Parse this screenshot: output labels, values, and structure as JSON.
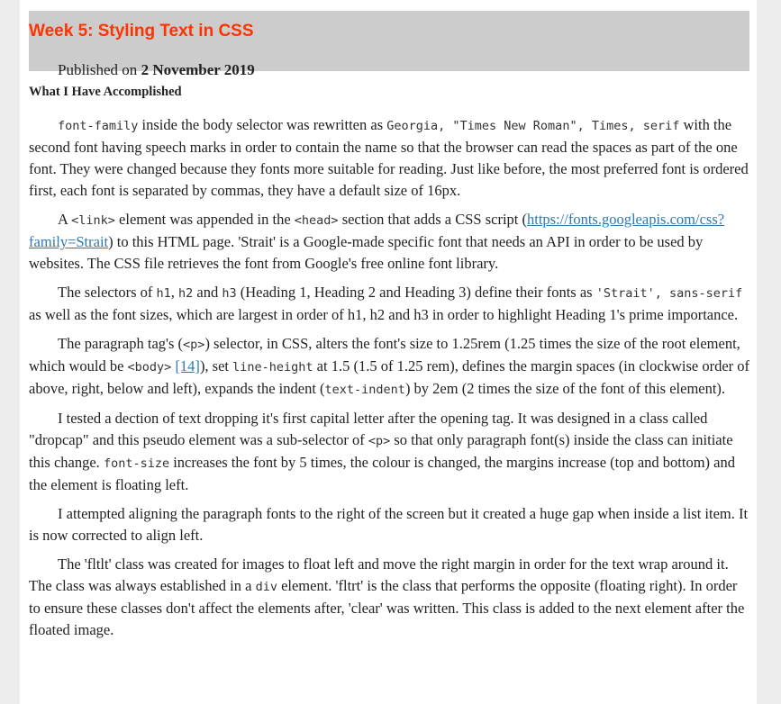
{
  "header": {
    "title": "Week 5: Styling Text in CSS",
    "published_prefix": "Published on ",
    "published_date": "2 November 2019"
  },
  "section_heading": "What I Have Accomplished",
  "p1": {
    "code_font_family": "font-family",
    "t1": " inside the body selector was rewritten as ",
    "code_fonts": "Georgia, \"Times New Roman\", Times, serif",
    "t2": " with the second font having speech marks in order to contain the name so that the browser can read the spaces as part of the one font. They were changed because they fonts more suitable for reading. Just like before, the most preferred font is ordered first, each font is separated by commas, they have a default size of 16px."
  },
  "p2": {
    "t1": "A ",
    "code_link": "<link>",
    "t2": " element was appended in the ",
    "code_head": "<head>",
    "t3": " section that adds a CSS script (",
    "link_url": "https://fonts.googleapis.com/css?family=Strait",
    "t4": ") to this HTML page. 'Strait' is a Google-made specific font that needs an API in order to be used by websites. The CSS file retrieves the font from Google's free online font library."
  },
  "p3": {
    "t1": "The selectors of ",
    "code_h1": "h1",
    "t2": ", ",
    "code_h2": "h2",
    "t3": " and ",
    "code_h3": "h3",
    "t4": " (Heading 1, Heading 2 and Heading 3) define their fonts as ",
    "code_strait": "'Strait', sans-serif",
    "t5": " as well as the font sizes, which are largest in order of h1, h2 and h3 in order to highlight Heading 1's prime importance."
  },
  "p4": {
    "t1": "The paragraph tag's (",
    "code_p": "<p>",
    "t2": ") selector, in CSS, alters the font's size to 1.25rem (1.25 times the size of the root element, which would be ",
    "code_body": "<body>",
    "t3": " ",
    "ref": "[14]",
    "t4": "), set ",
    "code_line_height": "line-height",
    "t5": " at 1.5 (1.5 of 1.25 rem), defines the margin spaces (in clockwise order of above, right, below and left), expands the indent (",
    "code_text_indent": "text-indent",
    "t6": ") by 2em (2 times the size of the font of this element)."
  },
  "p5": {
    "t1": "I tested a dection of text dropping it's first capital letter after the opening tag. It was designed in a class called \"dropcap\" and this pseudo element was a sub-selector of ",
    "code_p": "<p>",
    "t2": " so that only paragraph font(s) inside the class can initiate this change. ",
    "code_font_size": "font-size",
    "t3": " increases the font by 5 times, the colour is changed, the margins increase (top and bottom) and the element is floating left."
  },
  "p6": {
    "t1": "I attempted aligning the paragraph fonts to the right of the screen but it created a huge gap when inside a list item. It is now corrected to align left."
  },
  "p7": {
    "t1": "The 'fltlt' class was created for images to float left and move the right margin in order for the text wrap around it. The class was always established in a ",
    "code_div": "div",
    "t2": " element. 'fltrt' is the class that performs the opposite (floating right). In order to ensure these classes don't affect the elements after, 'clear' was written. This class is added to the next element after the floated image."
  },
  "colors": {
    "title": "#ff3300",
    "header_bg": "#cccccc",
    "link": "#2a7ab0",
    "text": "#222222"
  }
}
